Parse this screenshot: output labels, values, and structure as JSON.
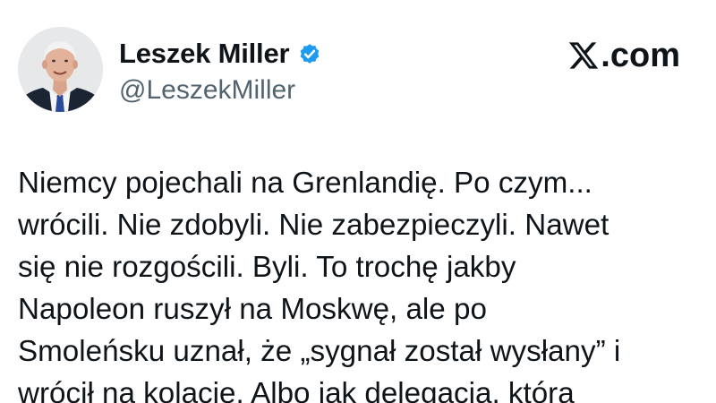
{
  "author": {
    "display_name": "Leszek Miller",
    "handle": "@LeszekMiller",
    "verified": true,
    "verified_icon": "verified-badge-icon",
    "avatar": "profile-photo"
  },
  "brand": {
    "label": ".com",
    "icon": "x-logo-icon"
  },
  "tweet": {
    "lines": [
      "Niemcy pojechali na Grenlandię. Po czym...",
      "wrócili. Nie zdobyli. Nie zabezpieczyli. Nawet",
      "się nie rozgościli. Byli. To trochę jakby",
      "Napoleon ruszył na Moskwę, ale po",
      "Smoleńsku uznał, że „sygnał został wysłany” i",
      "wrócił na kolacje. Albo jak delegacja, która"
    ]
  },
  "colors": {
    "text_primary": "#0f1419",
    "text_secondary": "#536471",
    "verified_blue": "#1d9bf0",
    "background": "#ffffff"
  }
}
